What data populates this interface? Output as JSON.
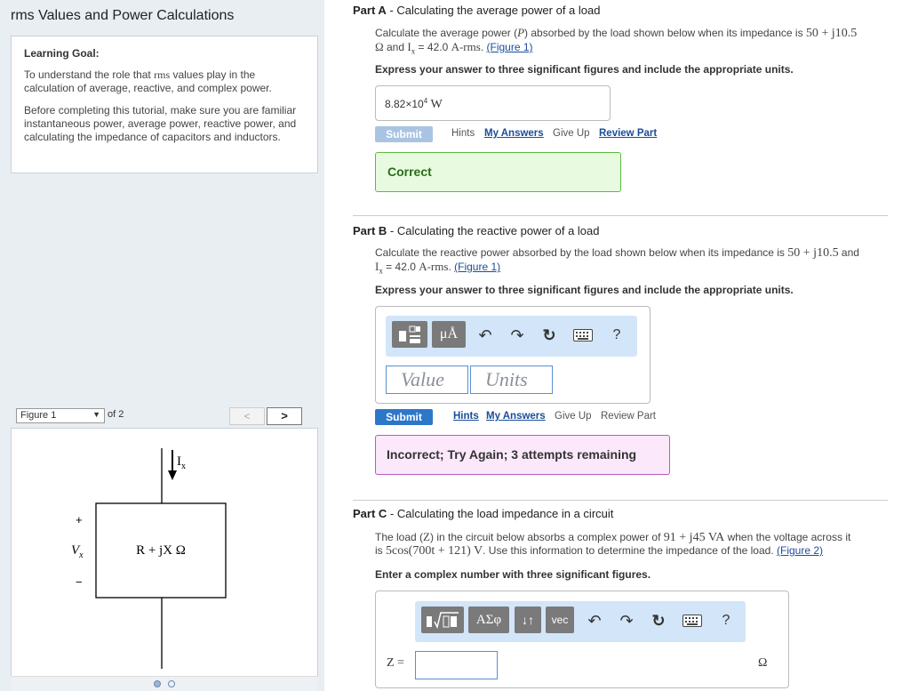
{
  "left": {
    "title": "rms Values and Power Calculations",
    "goal_heading": "Learning Goal:",
    "goal_p1_a": "To understand the role that ",
    "goal_p1_rms": "rms",
    "goal_p1_b": " values play in the calculation of average, reactive, and complex power.",
    "goal_p2": "Before completing this tutorial, make sure you are familiar instantaneous power, average power, reactive power, and calculating the impedance of capacitors and inductors.",
    "figure_select": "Figure 1",
    "figure_of": "of 2",
    "prev_label": "<",
    "next_label": ">",
    "figure": {
      "current_label": "I",
      "current_sub": "x",
      "voltage_label": "V",
      "voltage_sub": "x",
      "plus": "+",
      "minus": "−",
      "load_label": "R + jX Ω"
    }
  },
  "partA": {
    "part": "Part A",
    "title": " - Calculating the average power of a load",
    "text1": "Calculate the average power (",
    "text_P": "P",
    "text2": ") absorbed by the load shown below when its impedance is ",
    "impedance": "50 + j10.5",
    "text3": " and ",
    "current_sym": "I",
    "current_sub": "x",
    "text4": " = 42.0 ",
    "unit": "A-rms",
    "text5": ".",
    "fig_link": "(Figure 1)",
    "omega": "Ω",
    "instruction": "Express your answer to three significant figures and include the appropriate units.",
    "answer_mantissa": "8.82×10",
    "answer_exp": "4",
    "answer_unit": "W",
    "submit": "Submit",
    "hints": "Hints",
    "my_answers": "My Answers",
    "give_up": "Give Up",
    "review": "Review Part",
    "feedback": "Correct"
  },
  "partB": {
    "part": "Part B",
    "title": " - Calculating the reactive power of a load",
    "text1": "Calculate the reactive power absorbed by the load shown below when its impedance is ",
    "impedance": "50 + j10.5",
    "text2": " and",
    "current_sym": "I",
    "current_sub": "x",
    "text3": " = 42.0 ",
    "unit": "A-rms",
    "text4": ".",
    "fig_link": "(Figure 1)",
    "instruction": "Express your answer to three significant figures and include the appropriate units.",
    "toolbar_units": "μÅ",
    "toolbar_help": "?",
    "value_placeholder": "Value",
    "units_placeholder": "Units",
    "submit": "Submit",
    "hints": "Hints",
    "my_answers": "My Answers",
    "give_up": "Give Up",
    "review": "Review Part",
    "feedback": "Incorrect; Try Again; 3 attempts remaining"
  },
  "partC": {
    "part": "Part C",
    "title": " - Calculating the load impedance in a circuit",
    "text1": "The load (",
    "text_Z": "Z",
    "text2": ") in the circuit below absorbs a complex power of ",
    "power": "91 + j45 VA",
    "text3": " when the voltage across it",
    "text4": "is ",
    "voltage": "5cos(700t + 121) V",
    "text5": ". Use this information to determine the impedance of the load.",
    "fig_link": "(Figure 2)",
    "instruction": "Enter a complex number with three significant figures.",
    "toolbar_greek": "ΑΣφ",
    "toolbar_arrows": "↓↑",
    "toolbar_vec": "vec",
    "toolbar_help": "?",
    "z_label": "Z =",
    "omega": "Ω"
  }
}
